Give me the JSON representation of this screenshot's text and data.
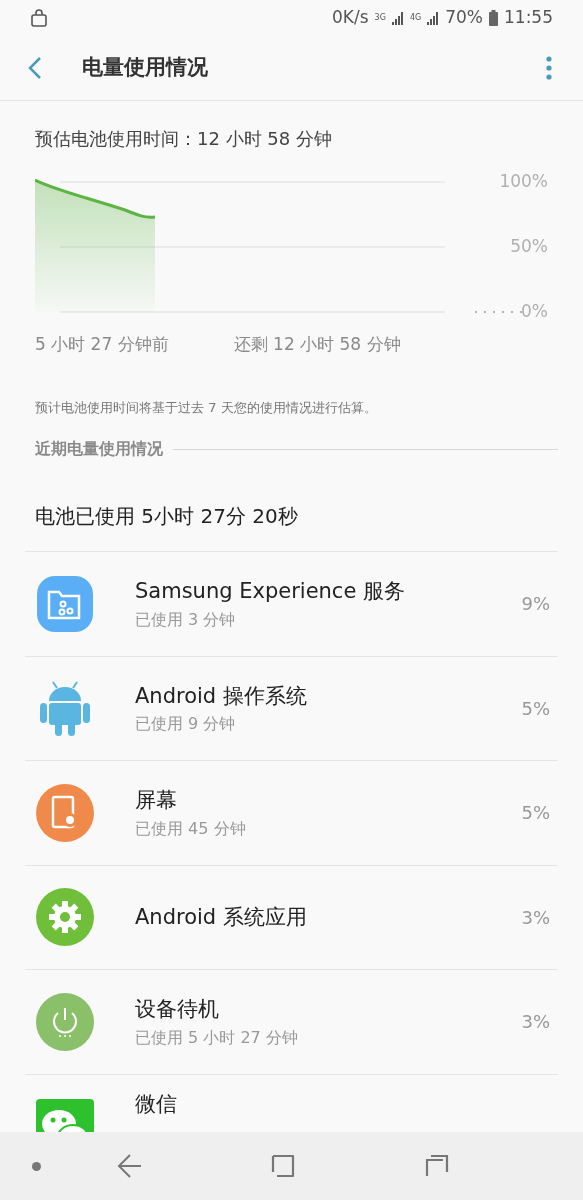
{
  "status_bar": {
    "speed": "0K/s",
    "network_1": "3G",
    "network_2": "4G",
    "battery": "70%",
    "time": "11:55"
  },
  "header": {
    "title": "电量使用情况"
  },
  "estimate": "预估电池使用时间：12 小时 58 分钟",
  "chart": {
    "y_labels": [
      "100%",
      "50%",
      "0%"
    ],
    "start_label": "5 小时 27 分钟前",
    "end_label": "还剩 12 小时 58 分钟"
  },
  "note": "预计电池使用时间将基于过去 7 天您的使用情况进行估算。",
  "section_title": "近期电量使用情况",
  "total": "电池已使用 5小时 27分 20秒",
  "apps": [
    {
      "kind": "folder",
      "name": "Samsung Experience 服务",
      "usage": "已使用 3 分钟",
      "percent": "9%"
    },
    {
      "kind": "android",
      "name": "Android 操作系统",
      "usage": "已使用 9 分钟",
      "percent": "5%"
    },
    {
      "kind": "screen",
      "name": "屏幕",
      "usage": "已使用 45 分钟",
      "percent": "5%"
    },
    {
      "kind": "gear",
      "name": "Android 系统应用",
      "percent": "3%"
    },
    {
      "kind": "power",
      "name": "设备待机",
      "usage": "已使用 5 小时 27 分钟",
      "percent": "3%"
    },
    {
      "kind": "chat",
      "name": "微信"
    }
  ]
}
